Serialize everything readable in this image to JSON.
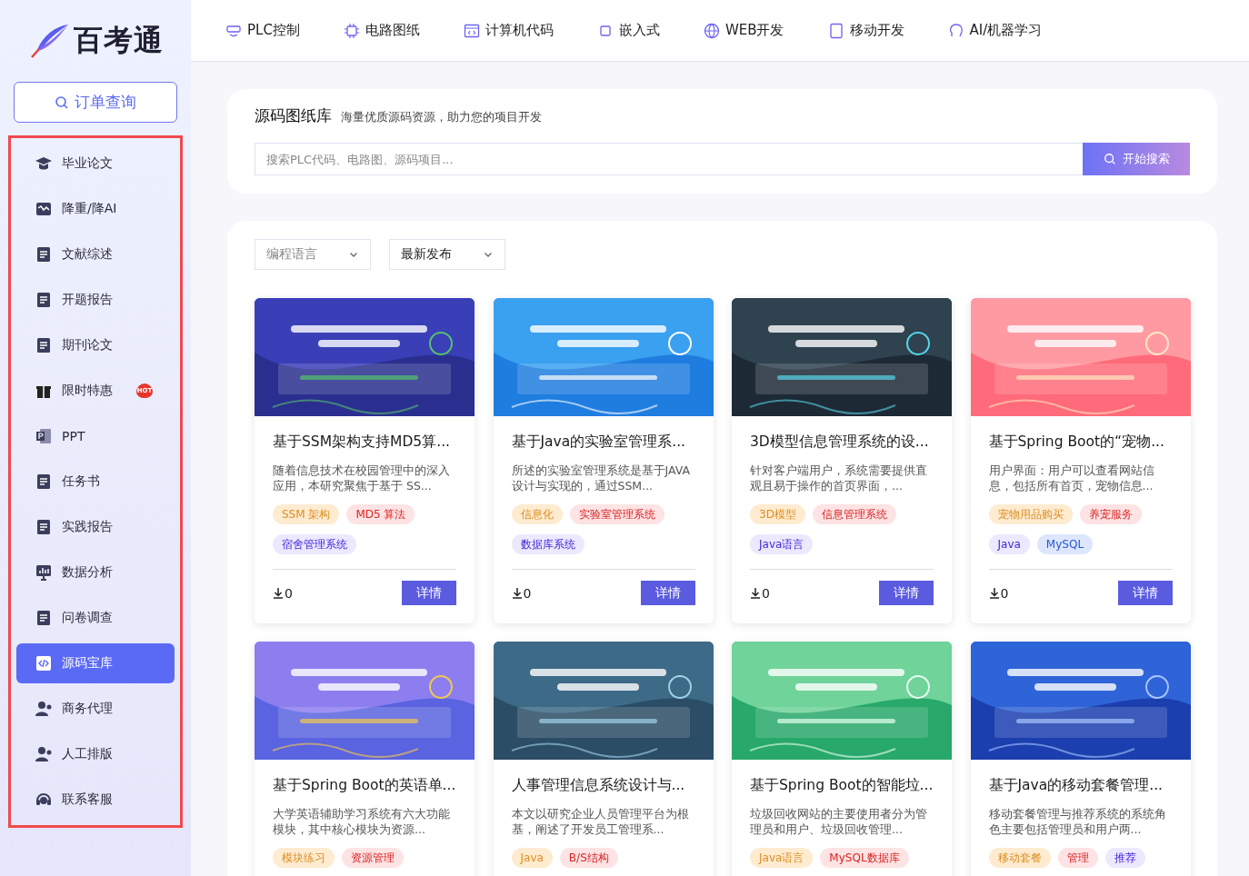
{
  "logo": {
    "text": "百考通"
  },
  "order_button": {
    "label": "订单查询"
  },
  "sidebar": {
    "items": [
      {
        "label": "毕业论文",
        "selected": false
      },
      {
        "label": "降重/降AI",
        "selected": false
      },
      {
        "label": "文献综述",
        "selected": false
      },
      {
        "label": "开题报告",
        "selected": false
      },
      {
        "label": "期刊论文",
        "selected": false
      },
      {
        "label": "限时特惠",
        "selected": false,
        "badge": "HOT"
      },
      {
        "label": "PPT",
        "selected": false
      },
      {
        "label": "任务书",
        "selected": false
      },
      {
        "label": "实践报告",
        "selected": false
      },
      {
        "label": "数据分析",
        "selected": false
      },
      {
        "label": "问卷调查",
        "selected": false
      },
      {
        "label": "源码宝库",
        "selected": true
      },
      {
        "label": "商务代理",
        "selected": false
      },
      {
        "label": "人工排版",
        "selected": false
      },
      {
        "label": "联系客服",
        "selected": false
      }
    ]
  },
  "top_nav": [
    "PLC控制",
    "电路图纸",
    "计算机代码",
    "嵌入式",
    "WEB开发",
    "移动开发",
    "AI/机器学习"
  ],
  "library": {
    "title": "源码图纸库",
    "subtitle": "海量优质源码资源，助力您的项目开发",
    "search": {
      "placeholder": "搜索PLC代码、电路图、源码项目..."
    },
    "search_button": "开始搜索"
  },
  "filters": [
    {
      "placeholder": "编程语言"
    },
    {
      "value": "最新发布"
    }
  ],
  "cards": [
    {
      "title": "基于SSM架构支持MD5算...",
      "description": "随着信息技术在校园管理中的深入应用，本研究聚焦于基于 SS...",
      "tags": [
        {
          "text": "SSM 架构",
          "color": "#feebd0"
        },
        {
          "text": "MD5 算法",
          "color": "#fde3e3"
        },
        {
          "text": "宿舍管理系统",
          "color": "#ece8fd"
        }
      ],
      "downloads": "0",
      "button": "详情"
    },
    {
      "title": "基于Java的实验室管理系...",
      "description": "所述的实验室管理系统是基于JAVA设计与实现的，通过SSM...",
      "tags": [
        {
          "text": "信息化",
          "color": "#feebd0"
        },
        {
          "text": "实验室管理系统",
          "color": "#fde3e3"
        },
        {
          "text": "数据库系统",
          "color": "#ece8fd"
        }
      ],
      "downloads": "0",
      "button": "详情"
    },
    {
      "title": "3D模型信息管理系统的设...",
      "description": "针对客户端用户，系统需要提供直观且易于操作的首页界面，...",
      "tags": [
        {
          "text": "3D模型",
          "color": "#feebd0"
        },
        {
          "text": "信息管理系统",
          "color": "#fde3e3"
        },
        {
          "text": "Java语言",
          "color": "#ece8fd"
        }
      ],
      "downloads": "0",
      "button": "详情"
    },
    {
      "title": "基于Spring Boot的“宠物...",
      "description": "用户界面：用户可以查看网站信息，包括所有首页，宠物信息...",
      "tags": [
        {
          "text": "宠物用品购买",
          "color": "#feebd0"
        },
        {
          "text": "养宠服务",
          "color": "#fde3e3"
        },
        {
          "text": "Java",
          "color": "#ece8fd"
        },
        {
          "text": "MySQL",
          "color": "#dde6fd"
        }
      ],
      "downloads": "0",
      "button": "详情"
    },
    {
      "title": "基于Spring Boot的英语单...",
      "description": "大学英语辅助学习系统有六大功能模块，其中核心模块为资源...",
      "tags": [
        {
          "text": "模块练习",
          "color": "#feebd0"
        },
        {
          "text": "资源管理",
          "color": "#fde3e3"
        }
      ]
    },
    {
      "title": "人事管理信息系统设计与...",
      "description": "本文以研究企业人员管理平台为根基，阐述了开发员工管理系...",
      "tags": [
        {
          "text": "Java",
          "color": "#feebd0"
        },
        {
          "text": "B/S结构",
          "color": "#fde3e3"
        }
      ]
    },
    {
      "title": "基于Spring Boot的智能垃...",
      "description": "垃圾回收网站的主要使用者分为管理员和用户、垃圾回收管理...",
      "tags": [
        {
          "text": "Java语言",
          "color": "#feebd0"
        },
        {
          "text": "MySQL数据库",
          "color": "#fde3e3"
        }
      ]
    },
    {
      "title": "基于Java的移动套餐管理...",
      "description": "移动套餐管理与推荐系统的系统角色主要包括管理员和用户两...",
      "tags": [
        {
          "text": "移动套餐",
          "color": "#feebd0"
        },
        {
          "text": "管理",
          "color": "#fde3e3"
        },
        {
          "text": "推荐",
          "color": "#ece8fd"
        }
      ]
    }
  ]
}
